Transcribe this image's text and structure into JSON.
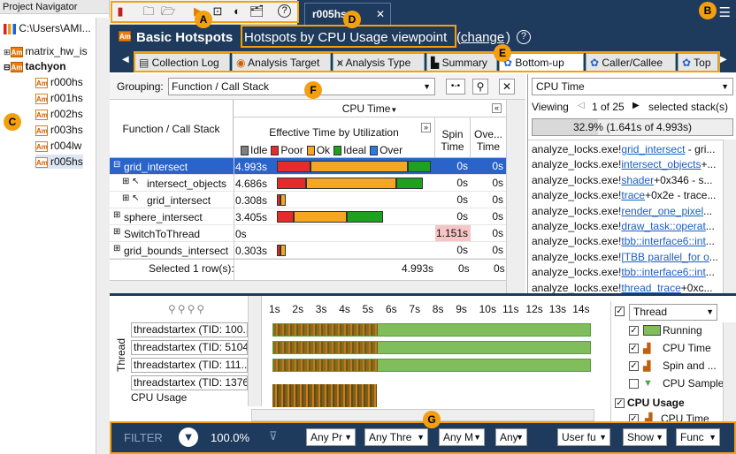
{
  "navigator": {
    "title": "Project Navigator",
    "root_path": "C:\\Users\\AMI...",
    "items": [
      {
        "label": "matrix_hw_is"
      },
      {
        "label": "tachyon"
      },
      {
        "label": "r000hs"
      },
      {
        "label": "r001hs"
      },
      {
        "label": "r002hs"
      },
      {
        "label": "r003hs"
      },
      {
        "label": "r004lw"
      },
      {
        "label": "r005hs"
      }
    ]
  },
  "tab": {
    "label": "r005hs",
    "close": "✕"
  },
  "header": {
    "title": "Basic Hotspots",
    "viewpoint": "Hotspots by CPU Usage viewpoint",
    "change": "change",
    "help": "?"
  },
  "subtabs": [
    {
      "label": "Collection Log"
    },
    {
      "label": "Analysis Target"
    },
    {
      "label": "Analysis Type"
    },
    {
      "label": "Summary"
    },
    {
      "label": "Bottom-up"
    },
    {
      "label": "Caller/Callee"
    },
    {
      "label": "Top"
    }
  ],
  "grouping": {
    "label": "Grouping:",
    "value": "Function / Call Stack"
  },
  "grid": {
    "col_function": "Function / Call Stack",
    "col_cputime": "CPU Time",
    "col_effective": "Effective Time by Utilization",
    "col_spin": "Spin Time",
    "col_over": "Ove... Time",
    "legend": [
      "Idle",
      "Poor",
      "Ok",
      "Ideal",
      "Over"
    ],
    "legend_colors": [
      "#808080",
      "#e52b2b",
      "#f5a623",
      "#1fa01f",
      "#2a7ae2"
    ],
    "rows": [
      {
        "name": "grid_intersect",
        "time": "4.993s",
        "spin": "0s",
        "over": "0s",
        "bars": [
          0.0,
          0.22,
          0.63,
          0.15
        ],
        "scale": 0.993
      },
      {
        "name": "intersect_objects",
        "time": "4.686s",
        "spin": "0s",
        "over": "0s",
        "bars": [
          0.0,
          0.2,
          0.62,
          0.18
        ],
        "scale": 0.932
      },
      {
        "name": "grid_intersect",
        "time": "0.308s",
        "spin": "0s",
        "over": "0s",
        "bars": [
          0.0,
          0.4,
          0.6,
          0.0
        ],
        "scale": 0.061
      },
      {
        "name": "sphere_intersect",
        "time": "3.405s",
        "spin": "0s",
        "over": "0s",
        "bars": [
          0.0,
          0.16,
          0.5,
          0.34
        ],
        "scale": 0.677
      },
      {
        "name": "SwitchToThread",
        "time": "0s",
        "spin": "1.151s",
        "over": "0s",
        "bars": [],
        "scale": 0
      },
      {
        "name": "grid_bounds_intersect",
        "time": "0.303s",
        "spin": "0s",
        "over": "0s",
        "bars": [
          0.0,
          0.4,
          0.6,
          0.0
        ],
        "scale": 0.06
      }
    ],
    "footer_label": "Selected 1 row(s):",
    "footer_time": "4.993s",
    "footer_spin": "0s",
    "footer_over": "0s"
  },
  "rpanel": {
    "metric": "CPU Time",
    "viewing_label": "Viewing",
    "page": "1 of 25",
    "selected": "selected stack(s)",
    "percent_text": "32.9% (1.641s of 4.993s)",
    "percent": 0.329,
    "stacks": [
      {
        "prefix": "analyze_locks.exe!",
        "link": "grid_intersect",
        "suffix": " - gri..."
      },
      {
        "prefix": "analyze_locks.exe!",
        "link": "intersect_objects",
        "suffix": "+..."
      },
      {
        "prefix": "analyze_locks.exe!",
        "link": "shader",
        "suffix": "+0x346 - s..."
      },
      {
        "prefix": "analyze_locks.exe!",
        "link": "trace",
        "suffix": "+0x2e - trace..."
      },
      {
        "prefix": "analyze_locks.exe!",
        "link": "render_one_pixel",
        "suffix": "..."
      },
      {
        "prefix": "analyze_locks.exe!",
        "link": "draw_task::operat",
        "suffix": "..."
      },
      {
        "prefix": "analyze_locks.exe!",
        "link": "tbb::interface6::int",
        "suffix": "..."
      },
      {
        "prefix": "analyze_locks.exe!",
        "link": "[TBB parallel_for o",
        "suffix": "..."
      },
      {
        "prefix": "analyze_locks.exe!",
        "link": "tbb::interface6::int",
        "suffix": "..."
      },
      {
        "prefix": "analyze_locks.exe!",
        "link": "thread_trace",
        "suffix": "+0xc..."
      }
    ]
  },
  "timeline": {
    "ticks": [
      "1s",
      "2s",
      "3s",
      "4s",
      "5s",
      "6s",
      "7s",
      "8s",
      "9s",
      "10s",
      "11s",
      "12s",
      "13s",
      "14s"
    ],
    "threads_label": "Thread",
    "threads": [
      {
        "label": "threadstartex (TID: 100..."
      },
      {
        "label": "threadstartex (TID: 5104)"
      },
      {
        "label": "threadstartex (TID: 111..."
      },
      {
        "label": "threadstartex (TID: 1376)"
      }
    ],
    "cpu_usage_label": "CPU Usage",
    "legend_select": "Thread",
    "legend": [
      {
        "label": "Running",
        "checked": true
      },
      {
        "label": "CPU Time",
        "checked": true
      },
      {
        "label": "Spin and ...",
        "checked": true
      },
      {
        "label": "CPU Sample",
        "checked": false
      }
    ],
    "cpu_group": "CPU Usage",
    "cpu_group_item": "CPU Time"
  },
  "filter": {
    "label": "FILTER",
    "percent": "100.0%",
    "selects": [
      "Any Pr",
      "Any Thre",
      "Any M",
      "Any",
      "User fu",
      "Show",
      "Func"
    ]
  },
  "callouts": [
    "A",
    "B",
    "C",
    "D",
    "E",
    "F",
    "G"
  ]
}
